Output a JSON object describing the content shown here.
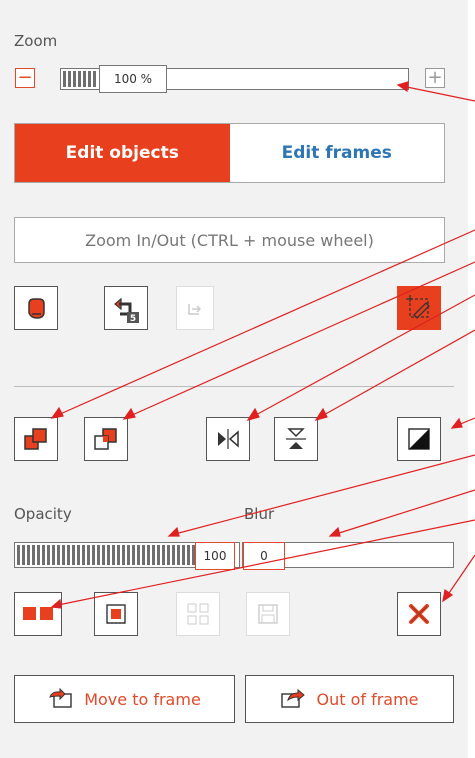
{
  "zoom": {
    "label": "Zoom",
    "value_text": "100 %",
    "level_fraction": 0.1,
    "minus_icon": "minus-icon",
    "plus_icon": "plus-icon"
  },
  "tabs": [
    {
      "label": "Edit objects",
      "active": true
    },
    {
      "label": "Edit frames",
      "active": false
    }
  ],
  "info": {
    "text": "Zoom In/Out (CTRL + mouse wheel)"
  },
  "toolbar1": {
    "items": [
      {
        "name": "hand-icon",
        "enabled": true
      },
      {
        "name": "undo-icon",
        "enabled": true,
        "badge": "5"
      },
      {
        "name": "redo-icon",
        "enabled": false
      },
      {
        "name": "select-tool-icon",
        "enabled": true,
        "active": true
      }
    ]
  },
  "toolbar2": {
    "items": [
      "bring-forward-icon",
      "send-backward-icon",
      "flip-horizontal-icon",
      "flip-vertical-icon",
      "contrast-icon"
    ]
  },
  "opacity": {
    "label": "Opacity",
    "value": "100",
    "level_fraction": 1.0
  },
  "blur": {
    "label": "Blur",
    "value": "0",
    "level_fraction": 0.0
  },
  "toolbar3": {
    "items": [
      {
        "name": "duplicate-icon",
        "enabled": true
      },
      {
        "name": "crop-icon",
        "enabled": true
      },
      {
        "name": "group-icon",
        "enabled": false
      },
      {
        "name": "save-icon",
        "enabled": false
      },
      {
        "name": "delete-icon",
        "enabled": true
      }
    ]
  },
  "frame_buttons": {
    "move_to_frame": "Move to frame",
    "out_of_frame": "Out of frame"
  },
  "colors": {
    "accent": "#e8401f",
    "link": "#2e75b5",
    "panel": "#f2f2f2"
  }
}
